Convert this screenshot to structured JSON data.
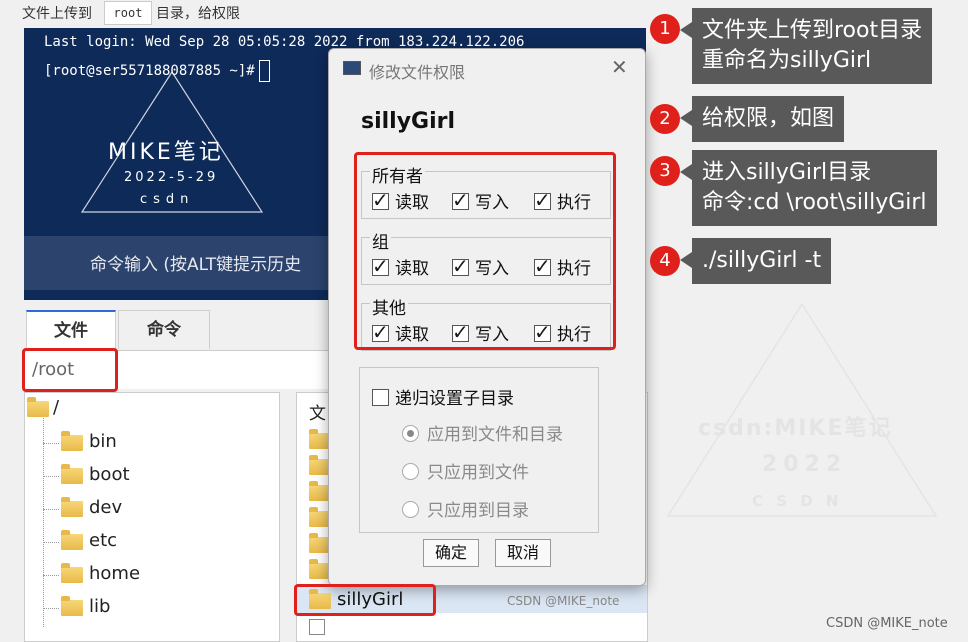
{
  "topbar": {
    "prefix": "文件上传到",
    "chip": "root",
    "suffix": "目录，给权限"
  },
  "terminal": {
    "line1": "Last login: Wed Sep 28 05:05:28 2022 from 183.224.122.206",
    "line2": "[root@ser557188087885 ~]#",
    "cmd_hint": "命令输入 (按ALT键提示历史",
    "watermark_title": "MIKE笔记",
    "watermark_date": "2022-5-29",
    "watermark_sub": "csdn"
  },
  "tabs": [
    {
      "label": "文件"
    },
    {
      "label": "命令"
    }
  ],
  "path": "/root",
  "tree": [
    {
      "label": "/"
    },
    {
      "label": "bin"
    },
    {
      "label": "boot"
    },
    {
      "label": "dev"
    },
    {
      "label": "etc"
    },
    {
      "label": "home"
    },
    {
      "label": "lib"
    }
  ],
  "filelist": {
    "header": "文",
    "highlight_item": "sillyGirl",
    "watermark": "CSDN @MIKE_note"
  },
  "dialog": {
    "title": "修改文件权限",
    "filename": "sillyGirl",
    "groups": [
      {
        "label": "所有者",
        "read": "读取",
        "write": "写入",
        "exec": "执行"
      },
      {
        "label": "组",
        "read": "读取",
        "write": "写入",
        "exec": "执行"
      },
      {
        "label": "其他",
        "read": "读取",
        "write": "写入",
        "exec": "执行"
      }
    ],
    "recursive": "递归设置子目录",
    "options": [
      "应用到文件和目录",
      "只应用到文件",
      "只应用到目录"
    ],
    "ok": "确定",
    "cancel": "取消"
  },
  "callouts": [
    {
      "num": "1",
      "line1": "文件夹上传到root目录",
      "line2": "重命名为sillyGirl"
    },
    {
      "num": "2",
      "line1": "给权限，如图"
    },
    {
      "num": "3",
      "line1": "进入sillyGirl目录",
      "line2": "命令:cd \\root\\sillyGirl"
    },
    {
      "num": "4",
      "line1": "./sillyGirl -t"
    }
  ],
  "right_watermark": {
    "line1": "csdn:MIKE笔记",
    "line2": "2022",
    "line3": "C S D N"
  },
  "footer": "CSDN @MIKE_note",
  "colors": {
    "accent_red": "#e0201a",
    "callout_bg": "#595959",
    "terminal_bg": "#0e2a59"
  }
}
